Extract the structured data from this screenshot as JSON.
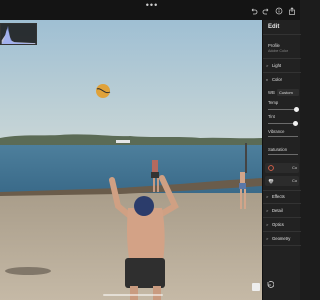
{
  "app": {
    "toolbar_ellipsis": "•••",
    "icons": [
      "undo-icon",
      "redo-icon",
      "info-icon",
      "share-icon"
    ]
  },
  "panel": {
    "title": "Edit",
    "profile_label": "Profile",
    "profile_value": "Adobe Color",
    "sections": {
      "light": "Light",
      "color": "Color",
      "effects": "Effects",
      "detail": "Detail",
      "optics": "Optics",
      "geometry": "Geometry"
    },
    "wb_label": "WB",
    "wb_value": "Custom",
    "temp_label": "Temp",
    "tint_label": "Tint",
    "vibrance_label": "Vibrance",
    "saturation_label": "Saturation",
    "chip1_label": "Co",
    "chip2_label": "Co",
    "sliders": {
      "temp": 0.95,
      "tint": 0.9
    }
  },
  "colors": {
    "panel_bg": "#222222",
    "topbar_bg": "#141414",
    "sky": "#a7c4d6",
    "sea": "#3b6c8a",
    "sand": "#b9ad9b",
    "ball": "#e0a23a"
  }
}
